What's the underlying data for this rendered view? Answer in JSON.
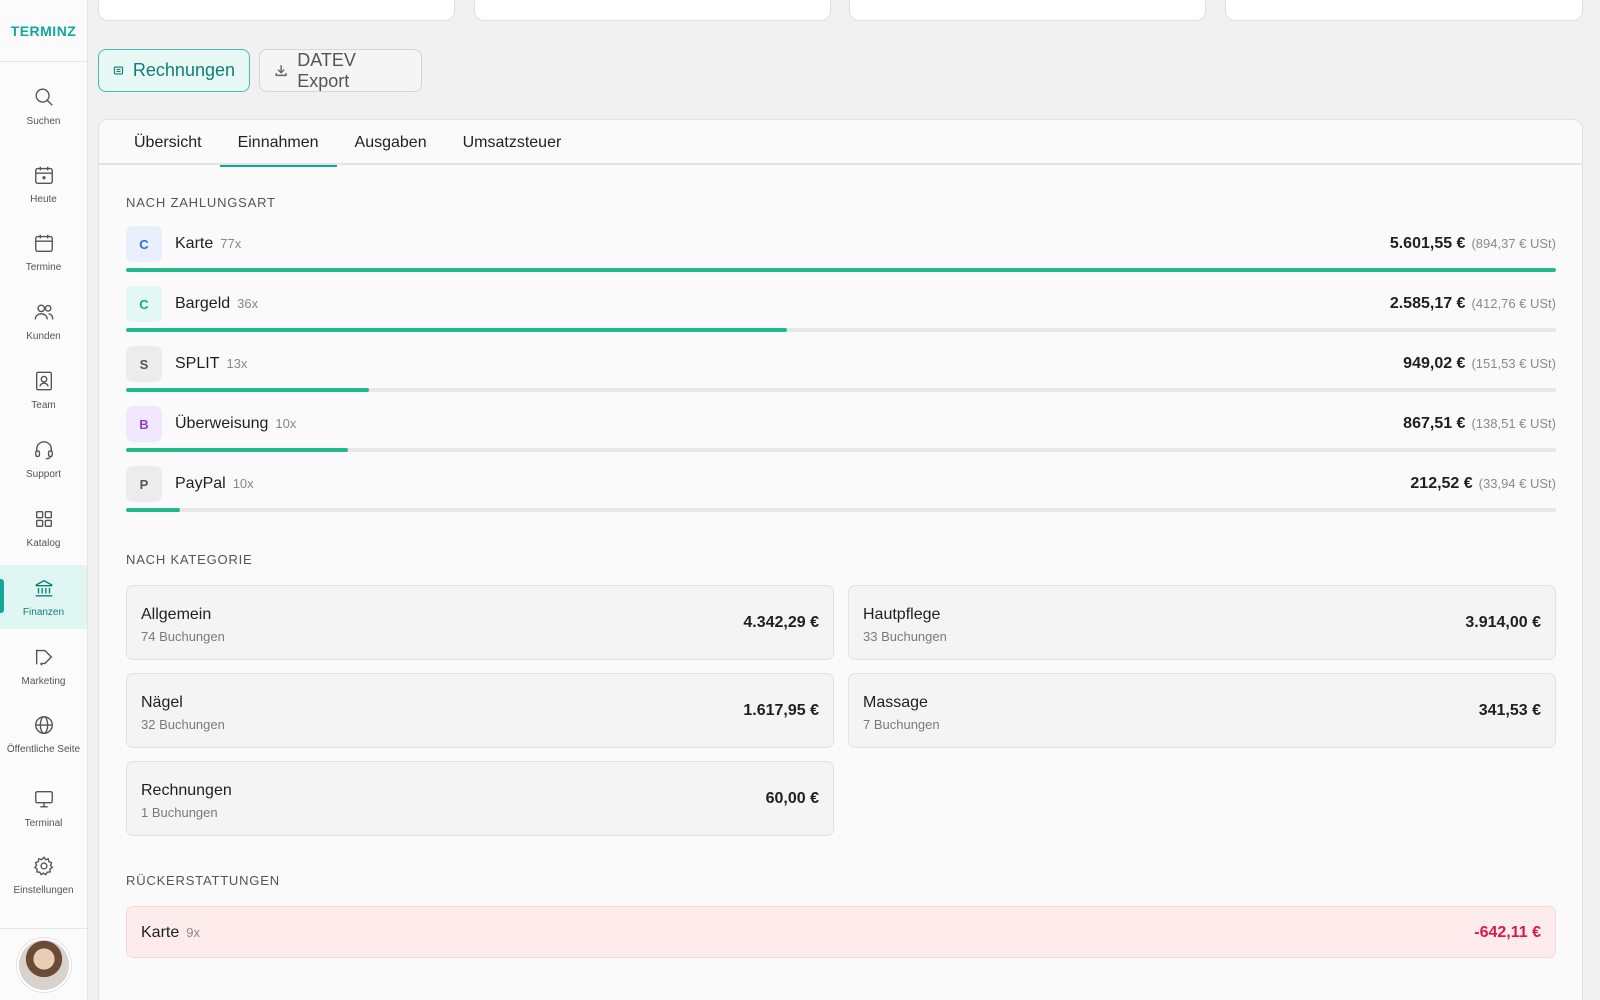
{
  "app": {
    "logo": "TERMINZ"
  },
  "sidebar": {
    "items": [
      {
        "label": "Suchen",
        "icon": "search-icon"
      },
      {
        "label": "Heute",
        "icon": "calendar-today-icon"
      },
      {
        "label": "Termine",
        "icon": "calendar-icon"
      },
      {
        "label": "Kunden",
        "icon": "users-icon"
      },
      {
        "label": "Team",
        "icon": "id-badge-icon"
      },
      {
        "label": "Support",
        "icon": "headset-icon"
      },
      {
        "label": "Katalog",
        "icon": "grid-icon"
      },
      {
        "label": "Finanzen",
        "icon": "bank-icon",
        "active": true
      },
      {
        "label": "Marketing",
        "icon": "megaphone-icon"
      },
      {
        "label": "Öffentliche Seite",
        "icon": "globe-icon"
      },
      {
        "label": "Terminal",
        "icon": "monitor-icon"
      },
      {
        "label": "Einstellungen",
        "icon": "gear-icon"
      }
    ]
  },
  "toolbar": {
    "invoices_label": "Rechnungen",
    "datev_label": "DATEV Export"
  },
  "tabs": [
    {
      "label": "Übersicht"
    },
    {
      "label": "Einnahmen",
      "active": true
    },
    {
      "label": "Ausgaben"
    },
    {
      "label": "Umsatzsteuer"
    }
  ],
  "payment_section": {
    "title": "NACH ZAHLUNGSART",
    "rows": [
      {
        "badge": "C",
        "badge_color": "#2f6fd6",
        "badge_bg": "#e8f0fd",
        "name": "Karte",
        "count": "77x",
        "amount": "5.601,55 €",
        "tax": "(894,37 € USt)",
        "share": 1.0
      },
      {
        "badge": "C",
        "badge_color": "#12a899",
        "badge_bg": "#e3f7f3",
        "name": "Bargeld",
        "count": "36x",
        "amount": "2.585,17 €",
        "tax": "(412,76 € USt)",
        "share": 0.462
      },
      {
        "badge": "S",
        "badge_color": "#555555",
        "badge_bg": "#ececec",
        "name": "SPLIT",
        "count": "13x",
        "amount": "949,02 €",
        "tax": "(151,53 € USt)",
        "share": 0.17
      },
      {
        "badge": "B",
        "badge_color": "#8a3fd6",
        "badge_bg": "#f1e8fd",
        "name": "Überweisung",
        "count": "10x",
        "amount": "867,51 €",
        "tax": "(138,51 € USt)",
        "share": 0.155
      },
      {
        "badge": "P",
        "badge_color": "#555555",
        "badge_bg": "#ececec",
        "name": "PayPal",
        "count": "10x",
        "amount": "212,52 €",
        "tax": "(33,94 € USt)",
        "share": 0.038
      }
    ]
  },
  "category_section": {
    "title": "NACH KATEGORIE",
    "cards": [
      {
        "name": "Allgemein",
        "sub": "74 Buchungen",
        "amount": "4.342,29 €"
      },
      {
        "name": "Hautpflege",
        "sub": "33 Buchungen",
        "amount": "3.914,00 €"
      },
      {
        "name": "Nägel",
        "sub": "32 Buchungen",
        "amount": "1.617,95 €"
      },
      {
        "name": "Massage",
        "sub": "7 Buchungen",
        "amount": "341,53 €"
      },
      {
        "name": "Rechnungen",
        "sub": "1 Buchungen",
        "amount": "60,00 €"
      }
    ]
  },
  "refund_section": {
    "title": "RÜCKERSTATTUNGEN",
    "rows": [
      {
        "name": "Karte",
        "count": "9x",
        "amount": "-642,11 €"
      }
    ]
  },
  "colors": {
    "accent": "#12a899",
    "bar": "#20b98a",
    "refund": "#d9184f"
  }
}
